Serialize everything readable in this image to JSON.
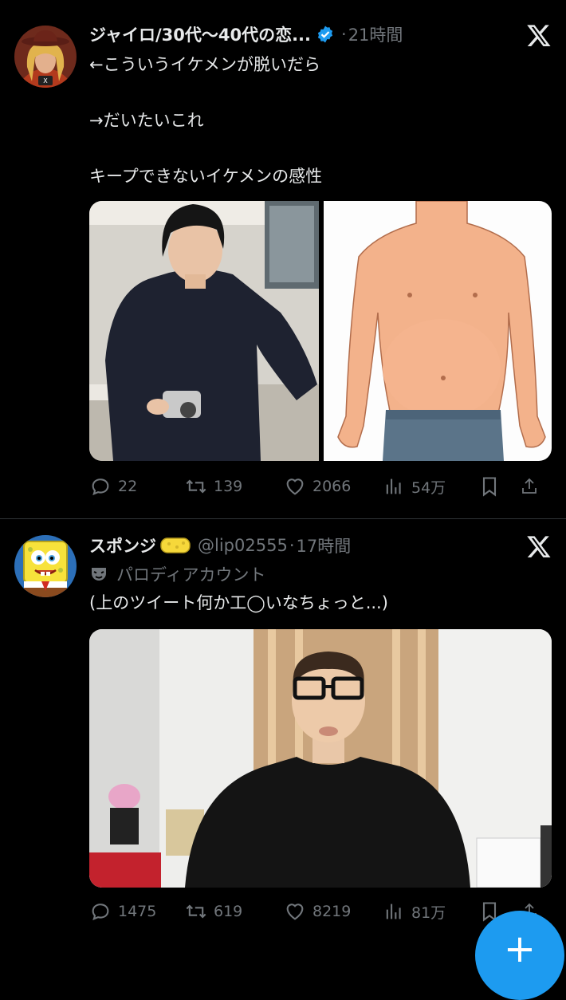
{
  "tweets": [
    {
      "name": "ジャイロ/30代〜40代の恋...",
      "verified": true,
      "separator": "·",
      "time": "21時間",
      "lines": [
        "←こういうイケメンが脱いだら",
        "",
        "→だいたいこれ",
        "",
        "キープできないイケメンの感性"
      ],
      "stats": {
        "replies": "22",
        "retweets": "139",
        "likes": "2066",
        "views": "54万"
      }
    },
    {
      "name": "スポンジ",
      "handle": "@lip02555",
      "separator": "·",
      "time": "17時間",
      "parody_label": "パロディアカウント",
      "text": "(上のツイート何か工◯いなちょっと...)",
      "stats": {
        "replies": "1475",
        "retweets": "619",
        "likes": "8219",
        "views": "81万"
      }
    }
  ],
  "fab": {
    "label": "+"
  },
  "icons": [
    "x-logo-icon",
    "verified-badge-icon",
    "reply-icon",
    "retweet-icon",
    "like-icon",
    "views-icon",
    "bookmark-icon",
    "share-icon",
    "parody-mask-icon"
  ],
  "colors": {
    "background": "#000000",
    "text": "#e7e9ea",
    "muted": "#71767b",
    "accent": "#1d9bf0"
  }
}
